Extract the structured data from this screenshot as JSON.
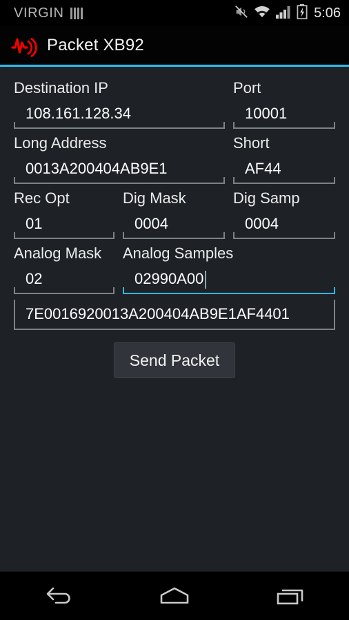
{
  "status_bar": {
    "carrier": "VIRGIN",
    "clock": "5:06",
    "icons": [
      "sim-card-icon",
      "mute-icon",
      "wifi-icon",
      "cellular-signal-icon",
      "battery-charging-icon"
    ]
  },
  "action_bar": {
    "title": "Packet XB92",
    "logo_icon": "packet-waveform-icon",
    "accent_color": "#33b5e5"
  },
  "form": {
    "rows": [
      {
        "fields": [
          {
            "label": "Destination IP",
            "value": "108.161.128.34",
            "focused": false
          },
          {
            "label": "Port",
            "value": "10001",
            "focused": false
          }
        ]
      },
      {
        "fields": [
          {
            "label": "Long Address",
            "value": "0013A200404AB9E1",
            "focused": false
          },
          {
            "label": "Short",
            "value": "AF44",
            "focused": false
          }
        ]
      },
      {
        "fields": [
          {
            "label": "Rec Opt",
            "value": "01",
            "focused": false
          },
          {
            "label": "Dig Mask",
            "value": "0004",
            "focused": false
          },
          {
            "label": "Dig Samp",
            "value": "0004",
            "focused": false
          }
        ]
      },
      {
        "fields": [
          {
            "label": "Analog Mask",
            "value": "02",
            "focused": false
          },
          {
            "label": "Analog Samples",
            "value": "02990A00",
            "focused": true
          }
        ]
      }
    ],
    "packet_output": {
      "value": "7E0016920013A200404AB9E1AF4401"
    },
    "send_button": {
      "label": "Send Packet"
    }
  },
  "nav_bar": {
    "buttons": [
      {
        "name": "back-icon",
        "label": "Back"
      },
      {
        "name": "home-icon",
        "label": "Home"
      },
      {
        "name": "recents-icon",
        "label": "Recent apps"
      }
    ]
  }
}
